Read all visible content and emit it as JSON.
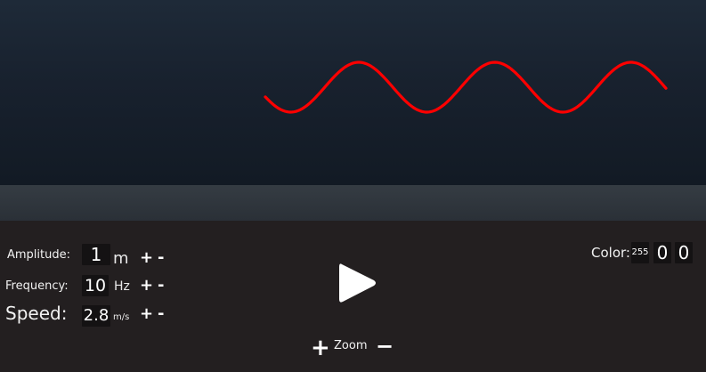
{
  "wave": {
    "color": "#ff0000",
    "amplitude_value": 1,
    "cycles_visible": 3
  },
  "controls": {
    "amplitude": {
      "label": "Amplitude:",
      "value": "1",
      "unit": "m",
      "plus": "+",
      "minus": "-"
    },
    "frequency": {
      "label": "Frequency:",
      "value": "10",
      "unit": "Hz",
      "plus": "+",
      "minus": "-"
    },
    "speed": {
      "label": "Speed:",
      "value": "2.8",
      "unit": "m/s",
      "plus": "+",
      "minus": "-"
    }
  },
  "play": {
    "icon": "play-icon"
  },
  "zoom": {
    "label": "Zoom",
    "plus": "+",
    "minus": "−"
  },
  "color": {
    "label": "Color:",
    "r": "255",
    "g": "0",
    "b": "0"
  }
}
